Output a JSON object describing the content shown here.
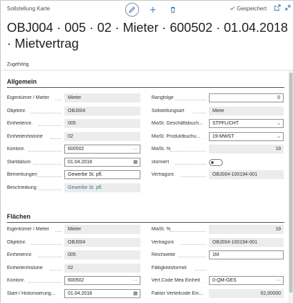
{
  "header": {
    "page_type": "Sollstellung Karte",
    "saved_label": "Gespeichert",
    "title": "OBJ004 · 005 · 02 · Mieter · 600502 · 01.04.2018 · Mietvertrag",
    "related_tab": "Zugehörig"
  },
  "icons": {
    "edit": "pencil-icon",
    "new": "plus-icon",
    "delete": "trash-icon",
    "saved": "check-icon",
    "open_new_window": "open-in-new-window-icon",
    "collapse": "collapse-icon"
  },
  "allgemein": {
    "title": "Allgemein",
    "left": [
      {
        "label": "Eigentümer / Mieter",
        "value": "Mieter",
        "kind": "ro"
      },
      {
        "label": "Objektnr.",
        "value": "OBJ004",
        "kind": "ro"
      },
      {
        "label": "Einheitennr.",
        "value": "005",
        "kind": "ro"
      },
      {
        "label": "Einheitenhistorie",
        "value": "02",
        "kind": "ro"
      },
      {
        "label": "Kontonr.",
        "value": "600502",
        "kind": "lookup"
      },
      {
        "label": "Startdatum",
        "value": "01.04.2018",
        "kind": "date"
      },
      {
        "label": "Bemerkungen",
        "value": "Gewerbe St. pfl.",
        "kind": "input"
      },
      {
        "label": "Beschreibung",
        "value": "Gewerbe St. pfl.",
        "kind": "link"
      }
    ],
    "right": [
      {
        "label": "Rangfolge",
        "value": "0",
        "kind": "number"
      },
      {
        "label": "Sollstellungsart",
        "value": "Miete",
        "kind": "ro"
      },
      {
        "label": "MwSt. Geschäftsbuch...",
        "value": "STPFLICHT",
        "kind": "select"
      },
      {
        "label": "MwSt. Produktbuchu...",
        "value": "19-MWST",
        "kind": "select"
      },
      {
        "label": "MwSt. %",
        "value": "19",
        "kind": "ro-right"
      },
      {
        "label": "storniert",
        "value": "",
        "kind": "toggle"
      },
      {
        "label": "Vertragsnr.",
        "value": "OBJ004-100194-001",
        "kind": "ro"
      }
    ]
  },
  "flaechen": {
    "title": "Flächen",
    "left": [
      {
        "label": "Eigentümer / Mieter",
        "value": "Mieter",
        "kind": "ro"
      },
      {
        "label": "Objektnr.",
        "value": "OBJ004",
        "kind": "ro"
      },
      {
        "label": "Einheitennr.",
        "value": "005",
        "kind": "ro"
      },
      {
        "label": "Einheitenhistorie",
        "value": "02",
        "kind": "ro"
      },
      {
        "label": "Kontonr.",
        "value": "600502",
        "kind": "lookup"
      },
      {
        "label": "Start-/ Historisierung...",
        "value": "01.04.2018",
        "kind": "date"
      }
    ],
    "right": [
      {
        "label": "MwSt. %",
        "value": "19",
        "kind": "ro-right"
      },
      {
        "label": "Vertragsnr.",
        "value": "OBJ004-100194-001",
        "kind": "ro"
      },
      {
        "label": "Reichweite",
        "value": "1M",
        "kind": "input"
      },
      {
        "label": "Fälligkeitsformel",
        "value": "",
        "kind": "blank"
      },
      {
        "label": "Vert.Code Mea Einheit",
        "value": "0-QM-GES",
        "kind": "lookup"
      },
      {
        "label": "Faktor Verteilcode Ein...",
        "value": "62,00000",
        "kind": "ro-right"
      }
    ]
  },
  "glyphs": {
    "lookup": "···",
    "calendar": "▦",
    "chevron": "⌄"
  }
}
